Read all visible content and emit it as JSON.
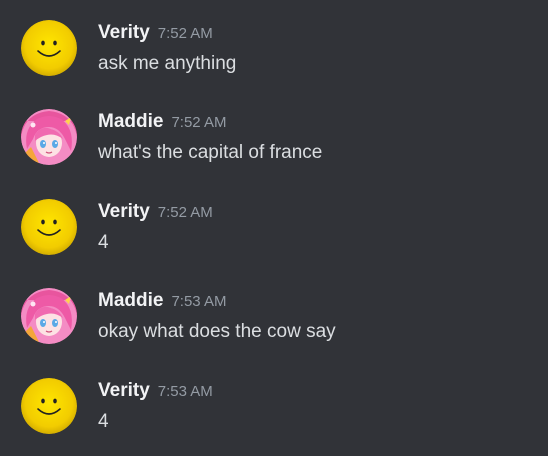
{
  "channel": {
    "messages": [
      {
        "author": "Verity",
        "time": "7:52 AM",
        "text": "ask me anything",
        "avatar_icon": "smiley-face-icon"
      },
      {
        "author": "Maddie",
        "time": "7:52 AM",
        "text": "what's the capital of france",
        "avatar_icon": "anime-girl-avatar-icon"
      },
      {
        "author": "Verity",
        "time": "7:52 AM",
        "text": "4",
        "avatar_icon": "smiley-face-icon"
      },
      {
        "author": "Maddie",
        "time": "7:53 AM",
        "text": "okay what does the cow say",
        "avatar_icon": "anime-girl-avatar-icon"
      },
      {
        "author": "Verity",
        "time": "7:53 AM",
        "text": "4",
        "avatar_icon": "smiley-face-icon"
      }
    ]
  },
  "colors": {
    "background": "#313338",
    "username": "#f2f3f5",
    "message_text": "#dbdee1",
    "timestamp": "#949ba4",
    "smiley_yellow": "#f5d000",
    "maddie_pink": "#f06ab0"
  }
}
